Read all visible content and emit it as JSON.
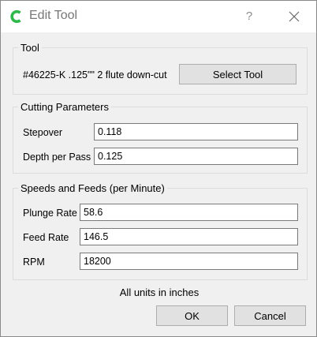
{
  "window": {
    "title": "Edit Tool",
    "help_glyph": "?",
    "app_icon": "carbide-c-icon",
    "accent_color": "#2fb84a"
  },
  "tool_group": {
    "title": "Tool",
    "tool_name": "#46225-K .125\"\" 2 flute down-cut",
    "select_button": "Select Tool"
  },
  "cutting": {
    "title": "Cutting Parameters",
    "stepover_label": "Stepover",
    "stepover_value": "0.118",
    "depth_label": "Depth per Pass",
    "depth_value": "0.125"
  },
  "speeds": {
    "title": "Speeds and Feeds (per Minute)",
    "plunge_label": "Plunge Rate",
    "plunge_value": "58.6",
    "feed_label": "Feed Rate",
    "feed_value": "146.5",
    "rpm_label": "RPM",
    "rpm_value": "18200"
  },
  "footer": {
    "units_note": "All units in inches",
    "ok_label": "OK",
    "cancel_label": "Cancel"
  }
}
